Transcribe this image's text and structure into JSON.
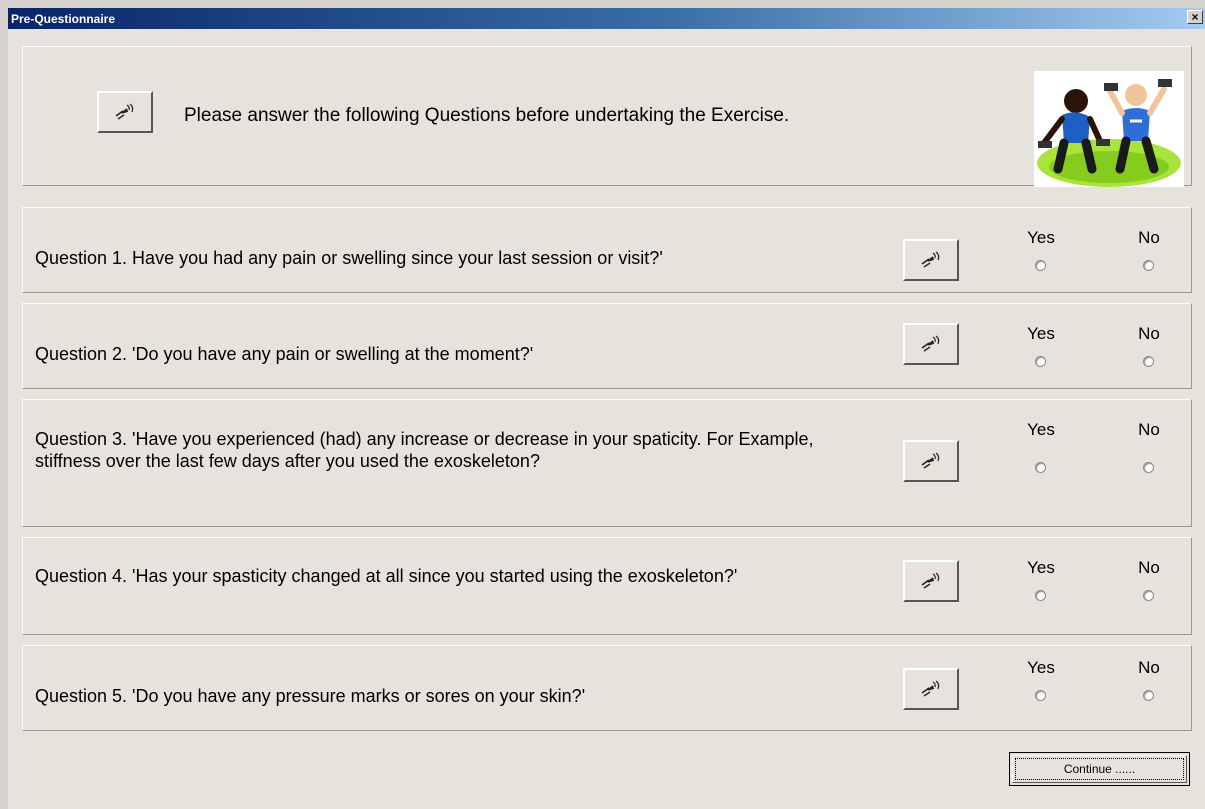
{
  "window": {
    "title": "Pre-Questionnaire",
    "close_label": "×"
  },
  "header": {
    "text": "Please answer the following Questions before undertaking the Exercise.",
    "speaker_icon": "speaker-sound-icon",
    "logo": "exercising-people-clipart"
  },
  "questions": [
    {
      "text": "Question 1. Have you had any pain or swelling since your last session or visit?'",
      "yes": "Yes",
      "no": "No"
    },
    {
      "text": "Question 2. 'Do you have any pain or swelling at the moment?'",
      "yes": "Yes",
      "no": "No"
    },
    {
      "text": "Question 3. 'Have you experienced (had) any increase or decrease in your spaticity. For Example, stiffness over the last few days after you used the exoskeleton?",
      "yes": "Yes",
      "no": "No"
    },
    {
      "text": "Question 4. 'Has your spasticity changed at all since you started using the exoskeleton?'",
      "yes": "Yes",
      "no": "No"
    },
    {
      "text": "Question 5. 'Do you have any pressure marks or sores on your skin?'",
      "yes": "Yes",
      "no": "No"
    }
  ],
  "continue_label": "Continue ......"
}
